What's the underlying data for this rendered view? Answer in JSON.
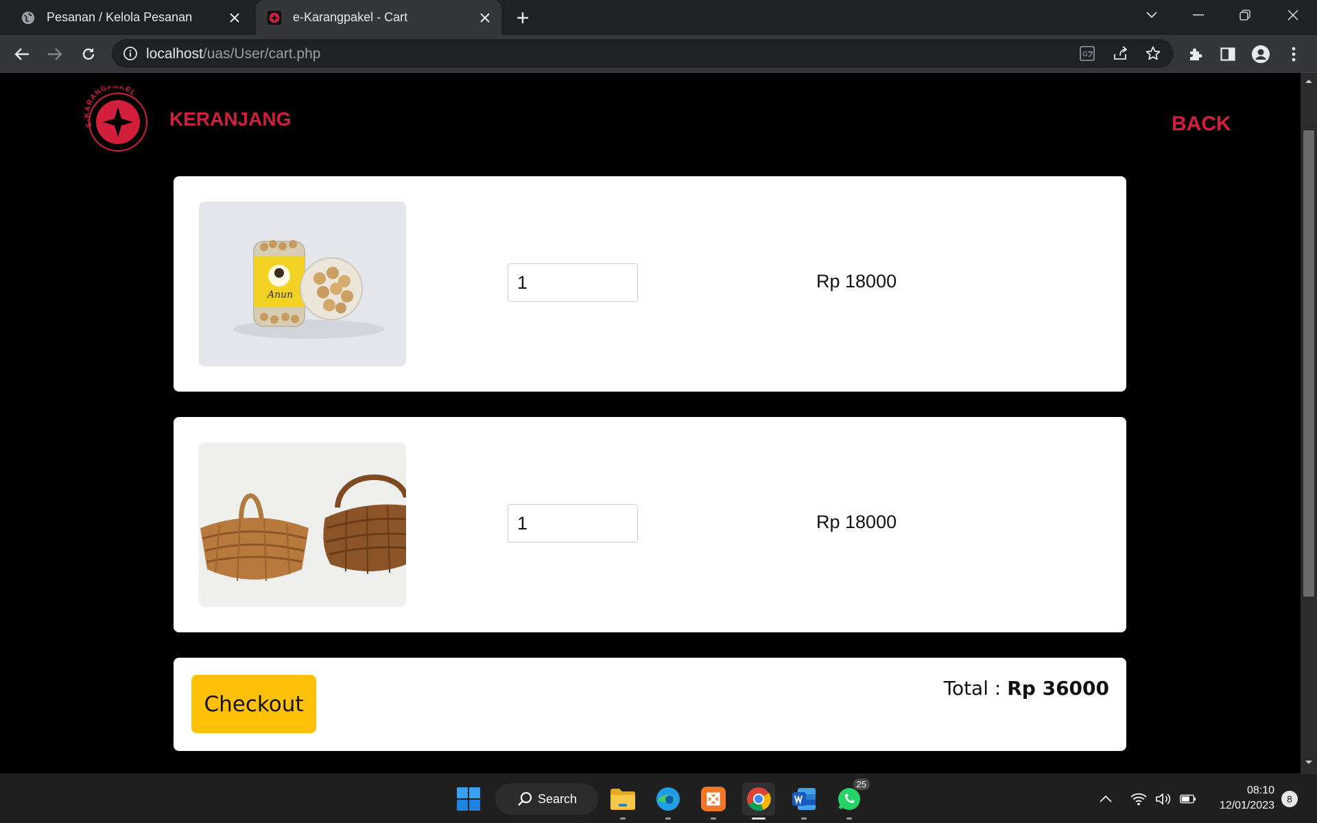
{
  "browser": {
    "tabs": [
      {
        "title": "Pesanan / Kelola Pesanan",
        "active": false
      },
      {
        "title": "e-Karangpakel - Cart",
        "active": true
      }
    ],
    "url_host": "localhost",
    "url_path": "/uas/User/cart.php"
  },
  "header": {
    "logo_text": "E-KARANGPAKEL",
    "title": "KERANJANG",
    "back_label": "BACK"
  },
  "cart": {
    "items": [
      {
        "image": "jar-of-snacks",
        "quantity": "1",
        "price": "Rp 18000"
      },
      {
        "image": "woven-baskets",
        "quantity": "1",
        "price": "Rp 18000"
      }
    ],
    "checkout_label": "Checkout",
    "total_label": "Total :",
    "total_value": "Rp 36000"
  },
  "taskbar": {
    "search_label": "Search",
    "whatsapp_badge": "25",
    "time": "08:10",
    "date": "12/01/2023",
    "notifications": "8"
  },
  "colors": {
    "accent_red": "#d21f3c",
    "checkout_yellow": "#ffc107",
    "page_background": "#000000"
  }
}
